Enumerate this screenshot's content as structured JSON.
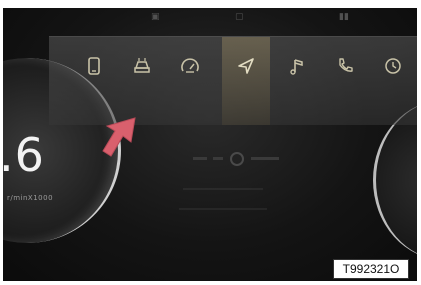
{
  "cluster": {
    "speed_fragment": ".6",
    "unit_label": "r/minX1000"
  },
  "menu": {
    "items": [
      {
        "label": "",
        "icon": "phone-icon"
      },
      {
        "label": "",
        "icon": "vehicle-icon"
      },
      {
        "label": "",
        "icon": "gauge-icon"
      },
      {
        "label": "",
        "icon": "navigation-icon",
        "selected": true
      },
      {
        "label": "",
        "icon": "music-icon"
      },
      {
        "label": "",
        "icon": "call-icon"
      },
      {
        "label": "",
        "icon": "history-icon"
      }
    ]
  },
  "figure_code": "T992321O",
  "colors": {
    "arrow": "#d9606d",
    "selected_tint": "#b4a06e"
  }
}
